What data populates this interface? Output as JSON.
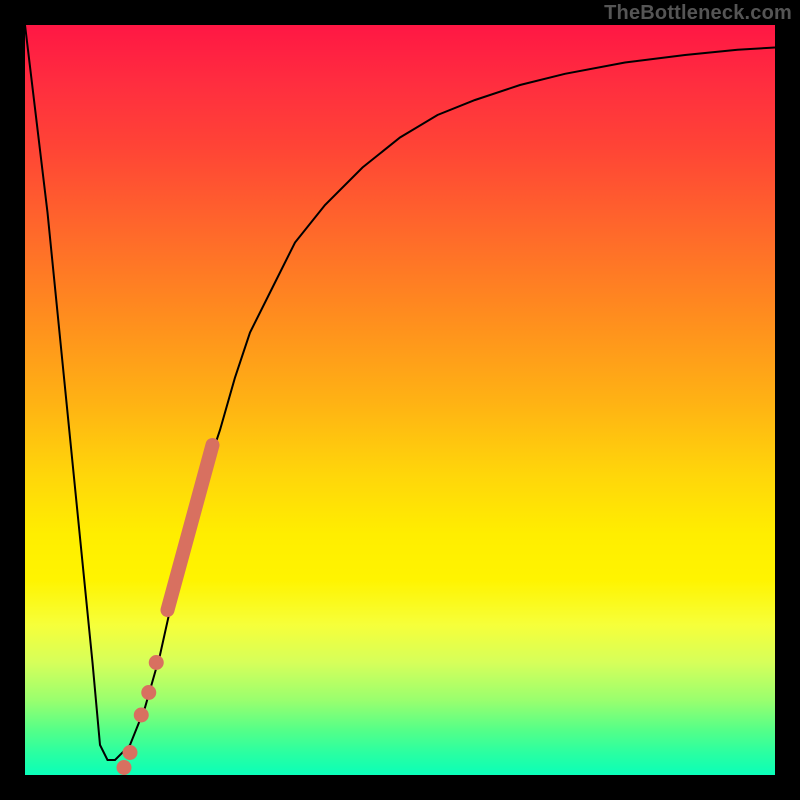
{
  "watermark": "TheBottleneck.com",
  "chart_data": {
    "type": "line",
    "title": "",
    "xlabel": "",
    "ylabel": "",
    "xlim": [
      0,
      100
    ],
    "ylim": [
      0,
      100
    ],
    "grid": false,
    "legend": false,
    "series": [
      {
        "name": "curve",
        "x": [
          0,
          3,
          6,
          9,
          10,
          11,
          12,
          14,
          16,
          18,
          20,
          22,
          24,
          26,
          28,
          30,
          33,
          36,
          40,
          45,
          50,
          55,
          60,
          66,
          72,
          80,
          88,
          95,
          100
        ],
        "y": [
          100,
          75,
          45,
          15,
          4,
          2,
          2,
          4,
          9,
          16,
          25,
          33,
          40,
          46,
          53,
          59,
          65,
          71,
          76,
          81,
          85,
          88,
          90,
          92,
          93.5,
          95,
          96,
          96.7,
          97
        ]
      }
    ],
    "markers": {
      "thick_segment": {
        "x0": 19,
        "y0": 22,
        "x1": 25,
        "y1": 44
      },
      "dots": [
        {
          "x": 17.5,
          "y": 15
        },
        {
          "x": 16.5,
          "y": 11
        },
        {
          "x": 15.5,
          "y": 8
        },
        {
          "x": 14.0,
          "y": 3
        },
        {
          "x": 13.2,
          "y": 1
        }
      ]
    },
    "colors": {
      "curve": "#000000",
      "marker": "#d87060",
      "bg_top": "#ff1744",
      "bg_bottom": "#0affbb",
      "frame": "#000000"
    }
  }
}
